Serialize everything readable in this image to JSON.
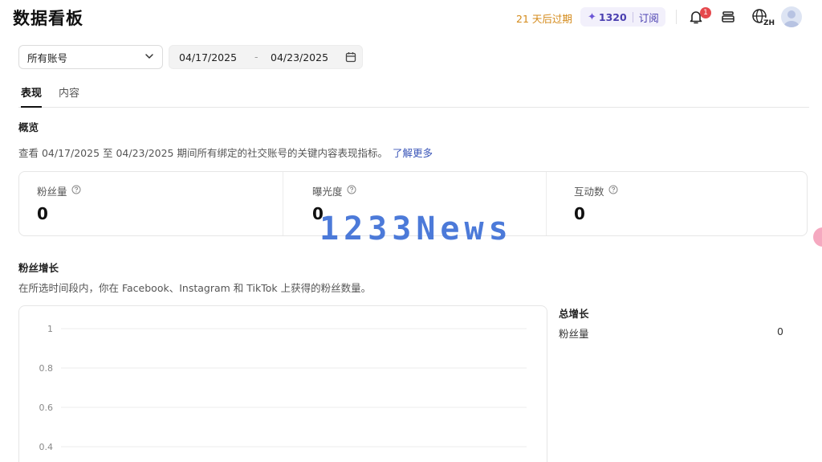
{
  "header": {
    "title": "数据看板",
    "trial_text": "21 天后过期",
    "credits": {
      "icon": "sparkle-icon",
      "amount": "1320",
      "subscribe_label": "订阅"
    },
    "notifications_count": "1",
    "language_code": "ZH"
  },
  "filters": {
    "account": "所有账号",
    "date_start": "04/17/2025",
    "date_separator": "-",
    "date_end": "04/23/2025"
  },
  "tabs": [
    {
      "label": "表现",
      "active": true
    },
    {
      "label": "内容",
      "active": false
    }
  ],
  "overview": {
    "heading": "概览",
    "description": "查看 04/17/2025 至 04/23/2025 期间所有绑定的社交账号的关键内容表现指标。",
    "learn_more": "了解更多",
    "metrics": [
      {
        "label": "粉丝量",
        "value": "0"
      },
      {
        "label": "曝光度",
        "value": "0"
      },
      {
        "label": "互动数",
        "value": "0"
      }
    ]
  },
  "growth": {
    "heading": "粉丝增长",
    "description": "在所选时间段内，你在 Facebook、Instagram 和 TikTok 上获得的粉丝数量。",
    "totals": {
      "title": "总增长",
      "rows": [
        {
          "label": "粉丝量",
          "value": "0"
        }
      ]
    }
  },
  "chart_data": {
    "type": "line",
    "y_ticks": [
      "1",
      "0.8",
      "0.6",
      "0.4"
    ],
    "ylim": [
      0,
      1
    ],
    "grid": true,
    "series": []
  },
  "watermark": "1233News",
  "colors": {
    "accent": "#3a55b8",
    "trial": "#d48a1a",
    "badge": "#e5484d",
    "credits_bg": "#f2f0fb"
  }
}
